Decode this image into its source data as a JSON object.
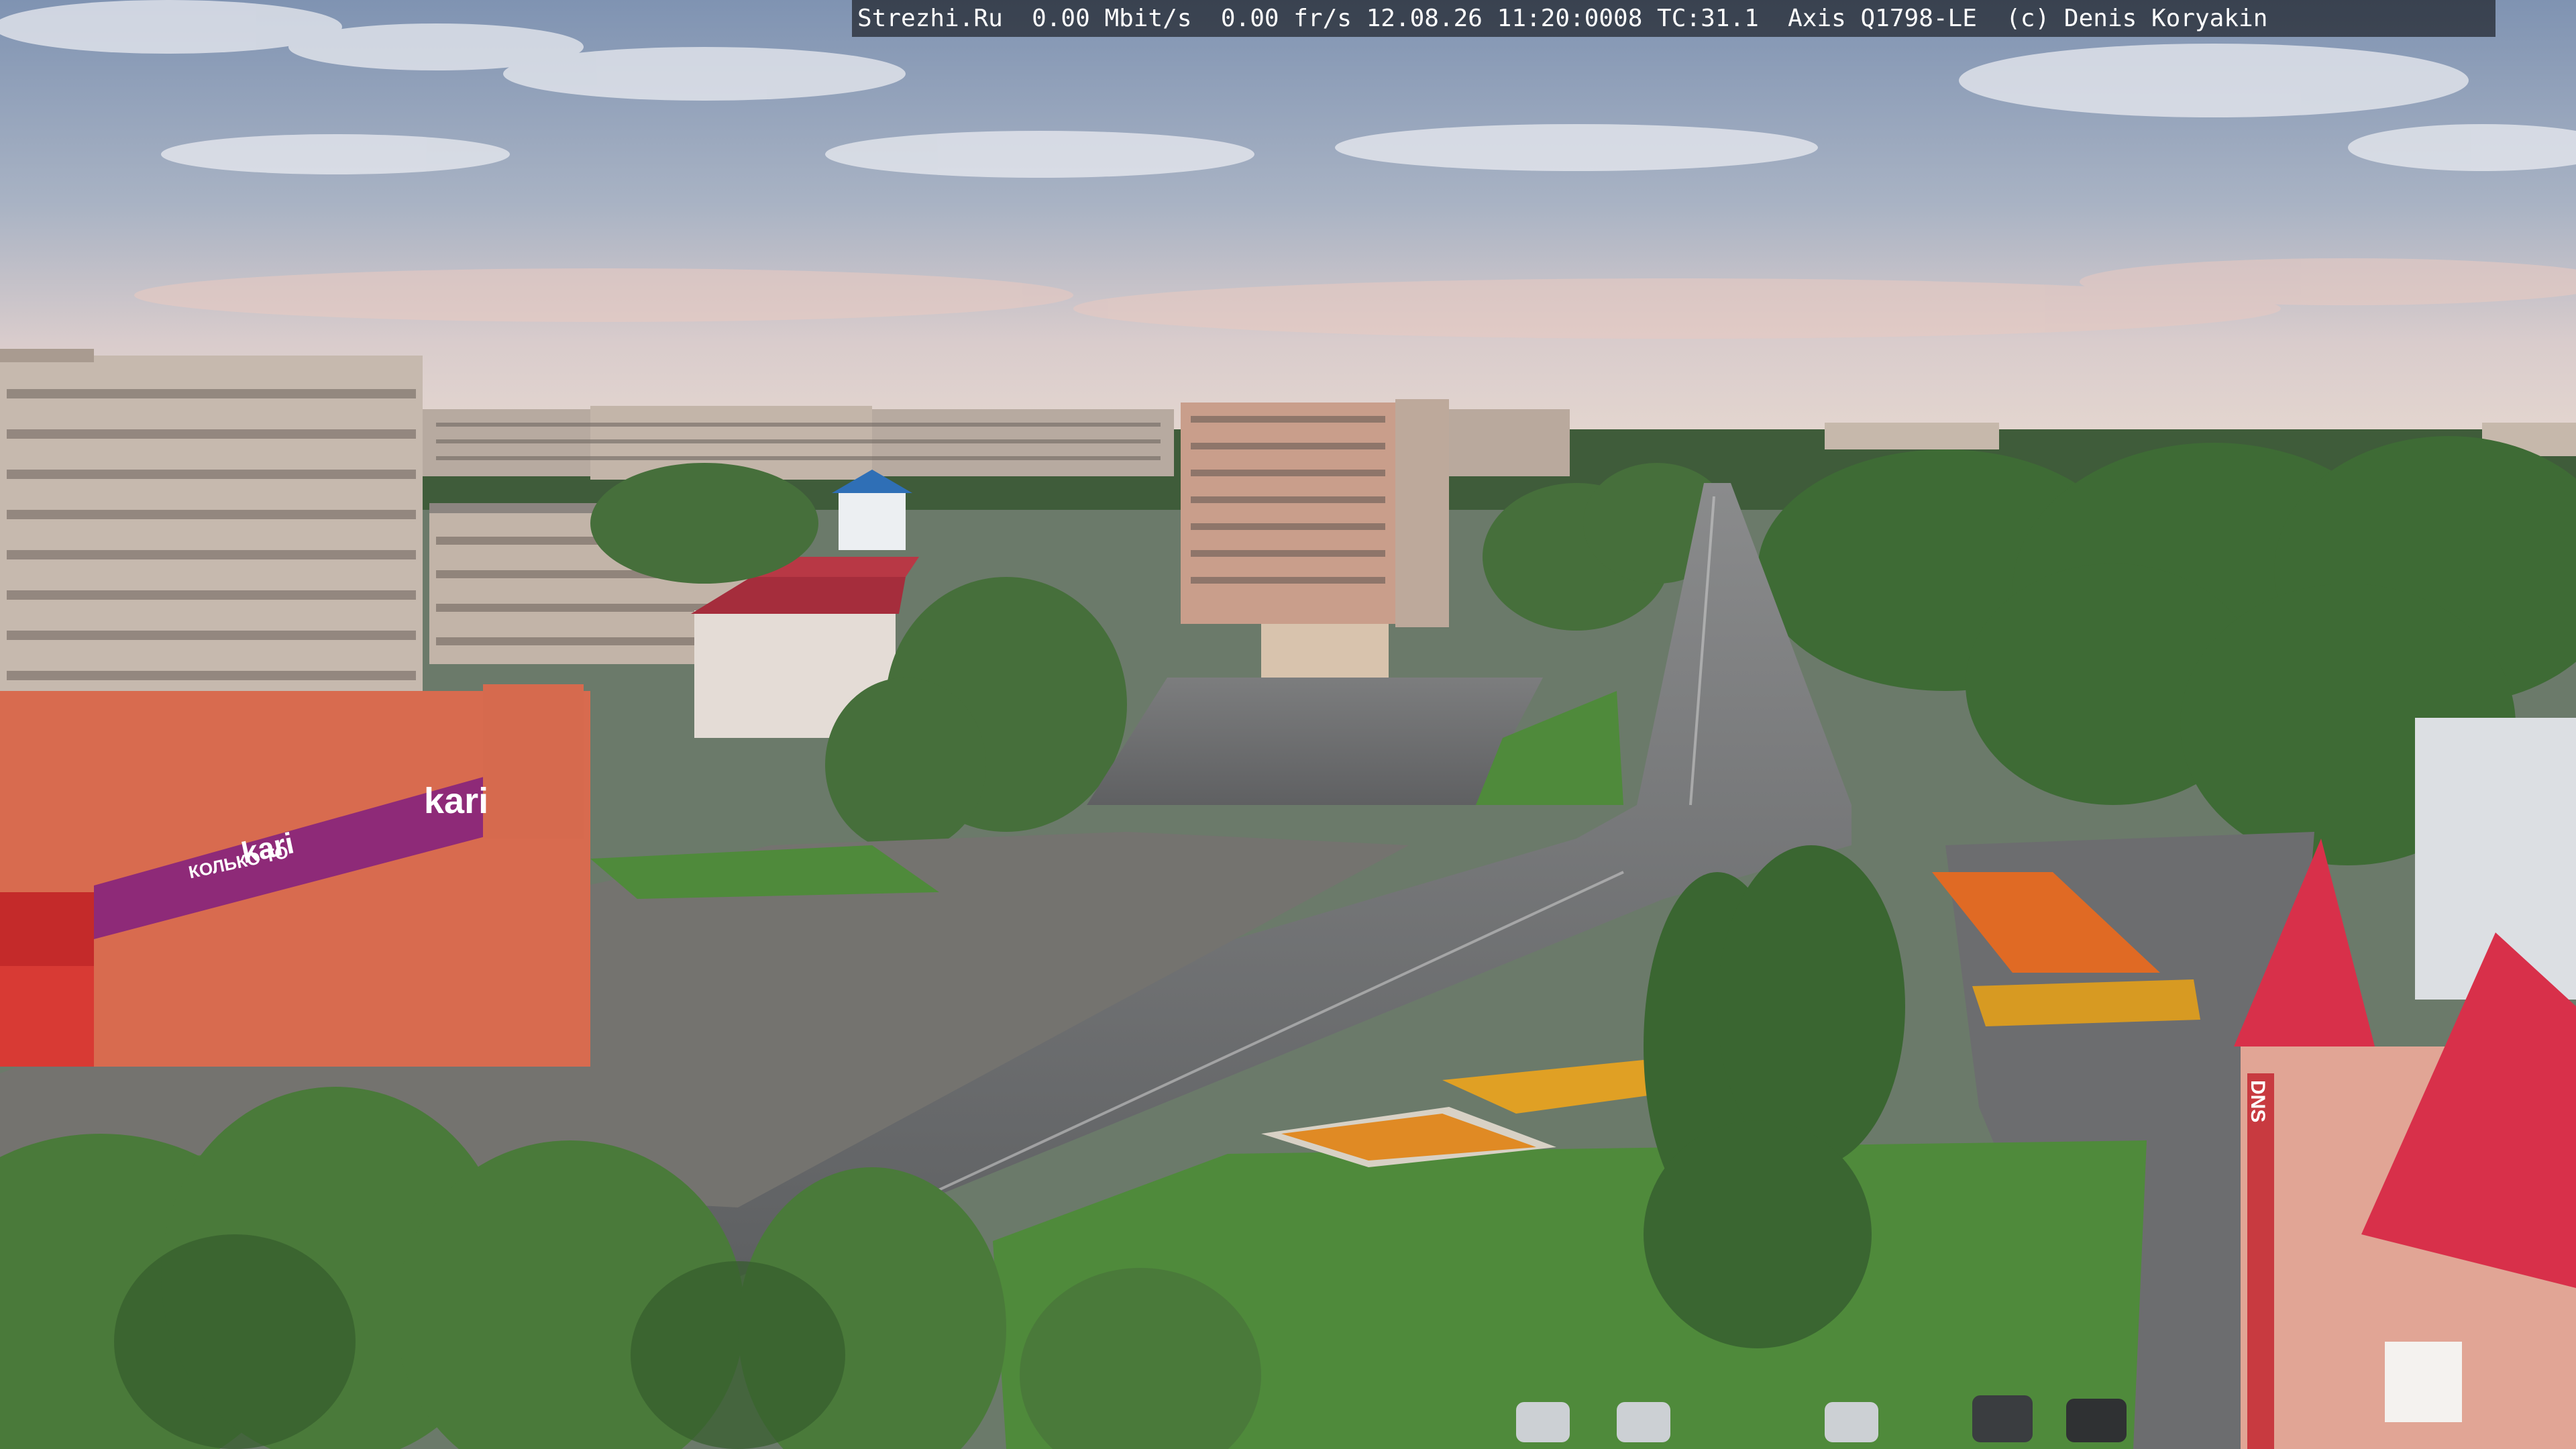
{
  "overlay": {
    "caption": "Strezhi.Ru  0.00 Mbit/s  0.00 fr/s 12.08.26 11:20:0008 TC:31.1  Axis Q1798-LE  (c) Denis Koryakin"
  },
  "signs": {
    "store_brand": "kari",
    "store_slogan_left": "КОЛЬКО ТО",
    "store_slogan_right": "kari",
    "store_building_label": "DNS"
  },
  "colors": {
    "sky_top": "#8fa0b6",
    "sky_bottom": "#e8d5cc",
    "trees": "#3e6b35",
    "road": "#6d6f70",
    "store_sign": "#8e2a78",
    "roof_red": "#d8304a"
  }
}
